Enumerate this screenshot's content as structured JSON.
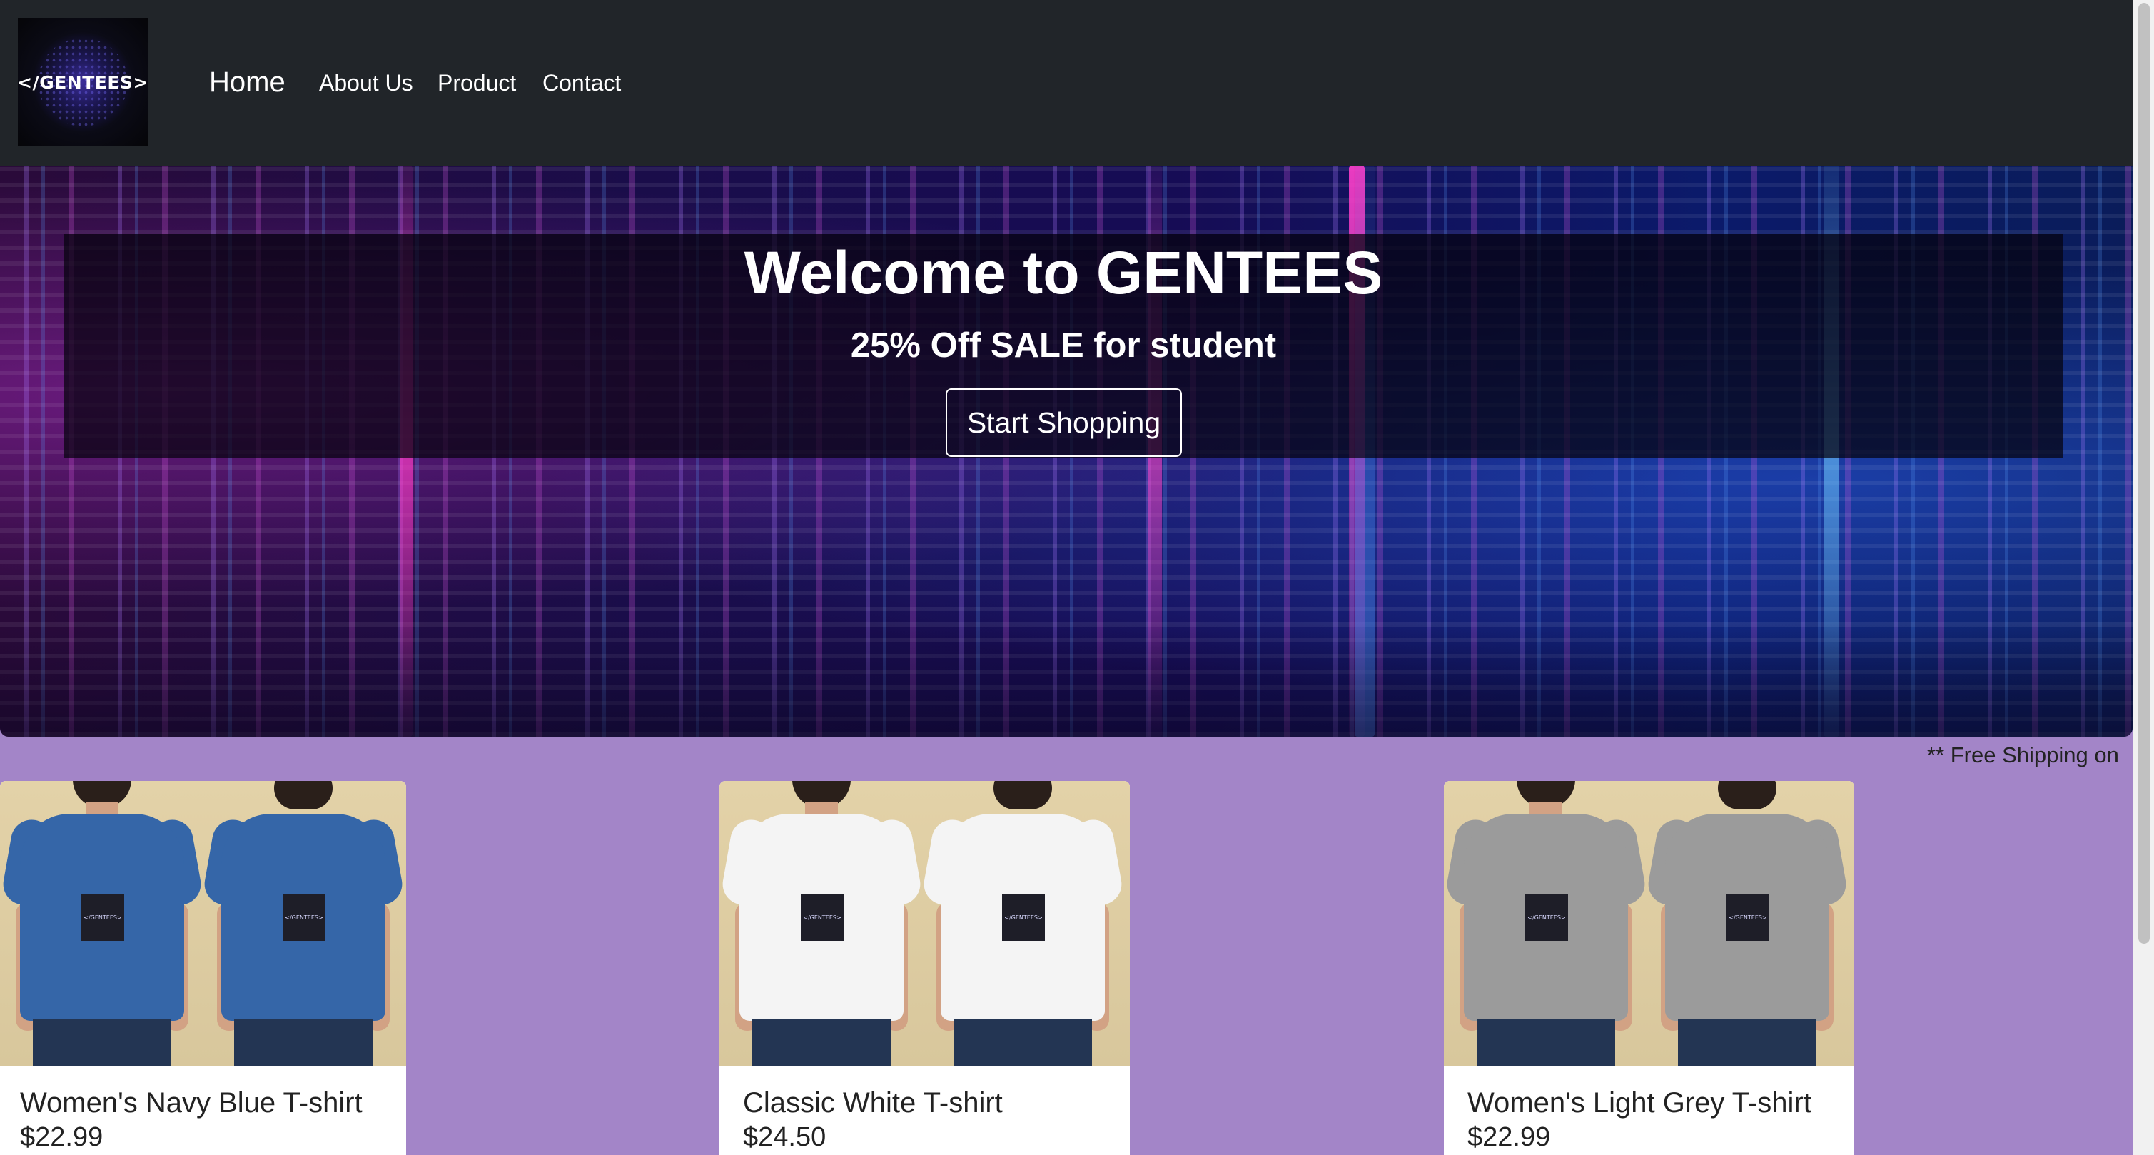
{
  "brand": {
    "logo_text": "</GENTEES>"
  },
  "nav": {
    "home": "Home",
    "about": "About Us",
    "product": "Product",
    "contact": "Contact"
  },
  "hero": {
    "title": "Welcome to GENTEES",
    "subtitle": "25% Off SALE for student",
    "button_label": "Start Shopping"
  },
  "marquee": {
    "text": "** Free Shipping on"
  },
  "products": [
    {
      "name": "Women's Navy Blue T-shirt",
      "price": "$22.99",
      "color": "#3566a8"
    },
    {
      "name": "Classic White T-shirt",
      "price": "$24.50",
      "color": "#f4f4f4"
    },
    {
      "name": "Women's Light Grey T-shirt",
      "price": "$22.99",
      "color": "#9b9b9b"
    }
  ],
  "colors": {
    "navbar_bg": "#212529",
    "page_bg": "#a385c8",
    "card_bg": "#ffffff"
  }
}
